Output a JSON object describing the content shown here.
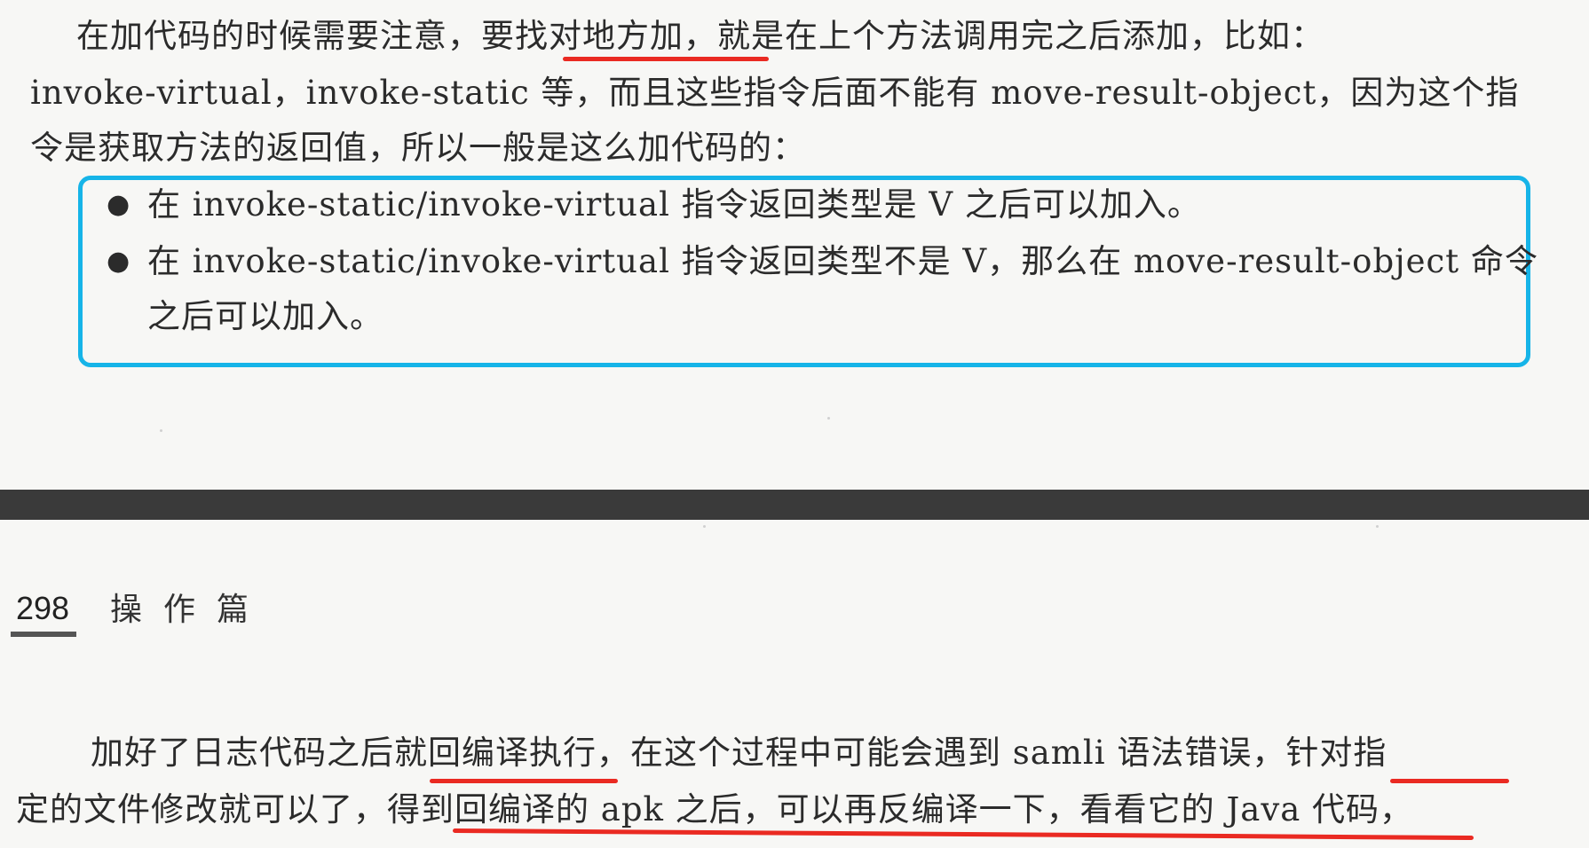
{
  "top_page": {
    "paragraph_lines": [
      "在加代码的时候需要注意，要找对地方加，就是在上个方法调用完之后添加，比如：",
      "invoke-virtual，invoke-static 等，而且这些指令后面不能有 move-result-object，因为这个指",
      "令是获取方法的返回值，所以一般是这么加代码的："
    ],
    "bullets": [
      {
        "lines": [
          "在 invoke-static/invoke-virtual 指令返回类型是 V 之后可以加入。"
        ]
      },
      {
        "lines": [
          "在 invoke-static/invoke-virtual 指令返回类型不是 V，那么在 move-result-object 命令",
          "之后可以加入。"
        ]
      }
    ],
    "bullet_symbol": "●"
  },
  "bottom_page": {
    "page_number": "298",
    "section_title": "操作篇",
    "paragraph_lines": [
      "加好了日志代码之后就回编译执行，在这个过程中可能会遇到 samli 语法错误，针对指",
      "定的文件修改就可以了，得到回编译的 apk 之后，可以再反编译一下，看看它的 Java 代码，"
    ]
  },
  "colors": {
    "highlight_box": "#16b4e8",
    "red_underline": "#ea2a22",
    "divider": "#3a3a3a",
    "paper": "#f7f7f5"
  }
}
